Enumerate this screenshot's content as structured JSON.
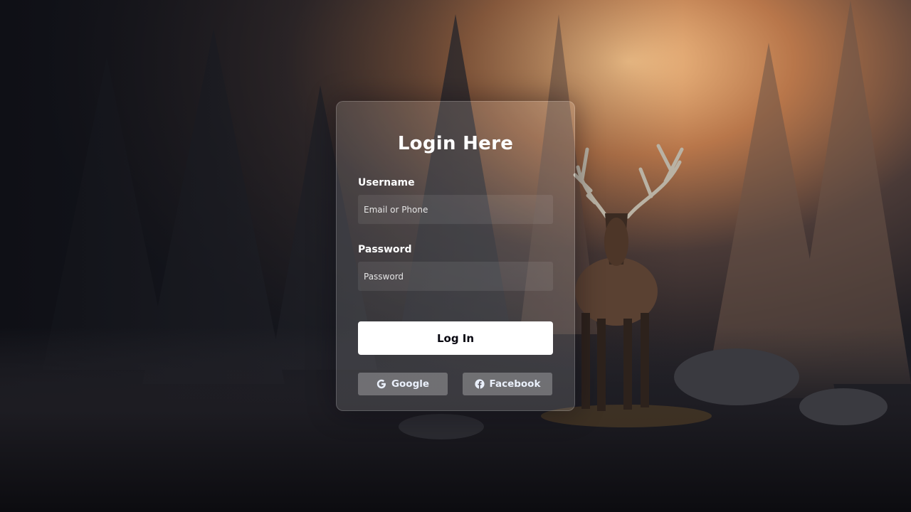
{
  "login": {
    "title": "Login Here",
    "username_label": "Username",
    "username_placeholder": "Email or Phone",
    "password_label": "Password",
    "password_placeholder": "Password",
    "submit_label": "Log In"
  },
  "social": {
    "google_label": "Google",
    "google_icon": "google-icon",
    "facebook_label": "Facebook",
    "facebook_icon": "facebook-icon"
  },
  "colors": {
    "card_background": "rgba(255,255,255,0.13)",
    "button_background": "#ffffff",
    "button_text": "#080710",
    "text": "#ffffff"
  }
}
